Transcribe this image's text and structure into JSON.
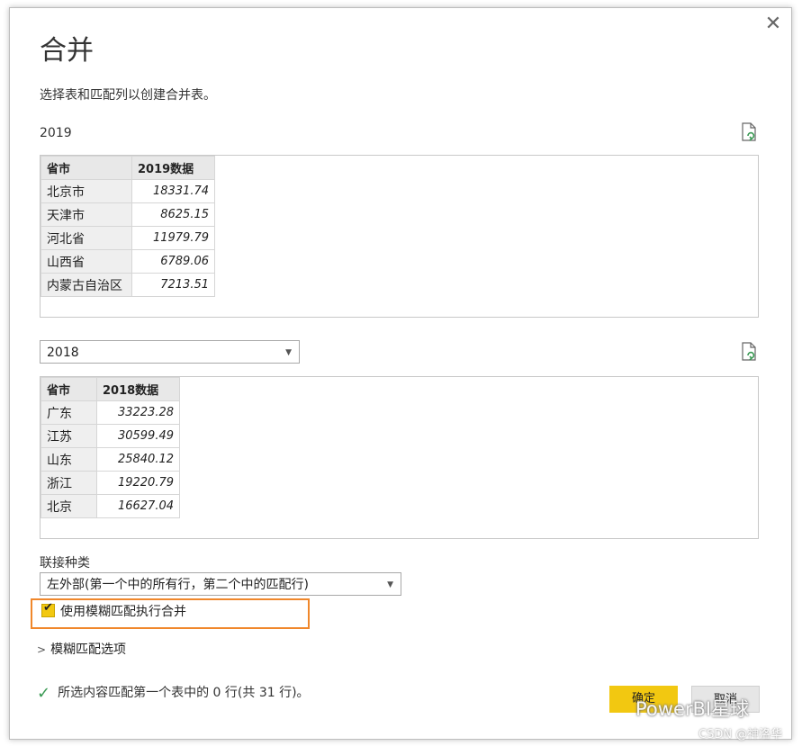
{
  "dialog": {
    "title": "合并",
    "subtitle": "选择表和匹配列以创建合并表。",
    "close_glyph": "✕"
  },
  "table1": {
    "label": "2019",
    "headers": [
      "省市",
      "2019数据"
    ],
    "rows": [
      [
        "北京市",
        "18331.74"
      ],
      [
        "天津市",
        "8625.15"
      ],
      [
        "河北省",
        "11979.79"
      ],
      [
        "山西省",
        "6789.06"
      ],
      [
        "内蒙古自治区",
        "7213.51"
      ]
    ]
  },
  "table2": {
    "selected": "2018",
    "headers": [
      "省市",
      "2018数据"
    ],
    "rows": [
      [
        "广东",
        "33223.28"
      ],
      [
        "江苏",
        "30599.49"
      ],
      [
        "山东",
        "25840.12"
      ],
      [
        "浙江",
        "19220.79"
      ],
      [
        "北京",
        "16627.04"
      ]
    ]
  },
  "join": {
    "label": "联接种类",
    "selected": "左外部(第一个中的所有行，第二个中的匹配行)"
  },
  "fuzzy": {
    "checkbox_label": "使用模糊匹配执行合并",
    "checked": true,
    "options_label": "模糊匹配选项"
  },
  "status": {
    "text": "所选内容匹配第一个表中的 0 行(共 31 行)。"
  },
  "buttons": {
    "ok": "确定",
    "cancel": "取消"
  },
  "watermark": {
    "line1": "PowerBI星球",
    "line2": "CSDN @神洛华"
  },
  "colors": {
    "accent": "#f2c811",
    "highlight": "#f0872b",
    "check": "#3a9a54"
  },
  "icons": [
    "close-icon",
    "refresh-file-icon",
    "chevron-down-icon",
    "chevron-right-icon",
    "checkmark-icon"
  ]
}
